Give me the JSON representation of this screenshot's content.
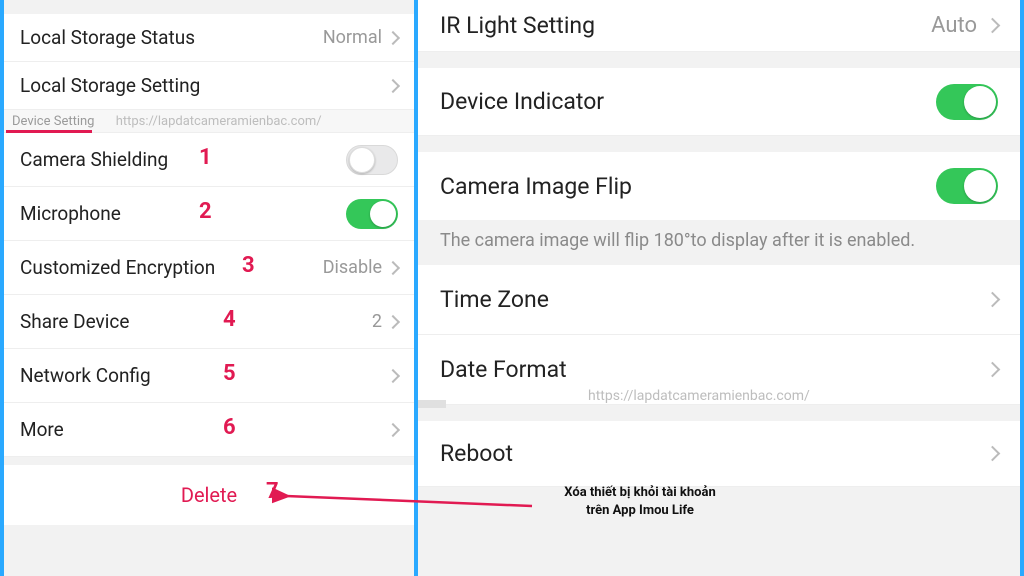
{
  "left": {
    "storage_status_label": "Local Storage Status",
    "storage_status_value": "Normal",
    "storage_setting_label": "Local Storage Setting",
    "section_header": "Device Setting",
    "watermark": "https://lapdatcameramienbac.com/",
    "camera_shielding_label": "Camera Shielding",
    "camera_shielding_num": "1",
    "microphone_label": "Microphone",
    "microphone_num": "2",
    "encryption_label": "Customized Encryption",
    "encryption_value": "Disable",
    "encryption_num": "3",
    "share_label": "Share Device",
    "share_value": "2",
    "share_num": "4",
    "network_label": "Network Config",
    "network_num": "5",
    "more_label": "More",
    "more_num": "6",
    "delete_label": "Delete",
    "delete_num": "7"
  },
  "right": {
    "ir_label": "IR Light Setting",
    "ir_value": "Auto",
    "indicator_label": "Device Indicator",
    "flip_label": "Camera Image Flip",
    "flip_helper": "The camera image will flip 180°to display after it is enabled.",
    "timezone_label": "Time Zone",
    "dateformat_label": "Date Format",
    "reboot_label": "Reboot",
    "watermark": "https://lapdatcameramienbac.com/"
  },
  "annotation": {
    "line1": "Xóa thiết bị khỏi tài khoản",
    "line2": "trên App Imou Life"
  }
}
